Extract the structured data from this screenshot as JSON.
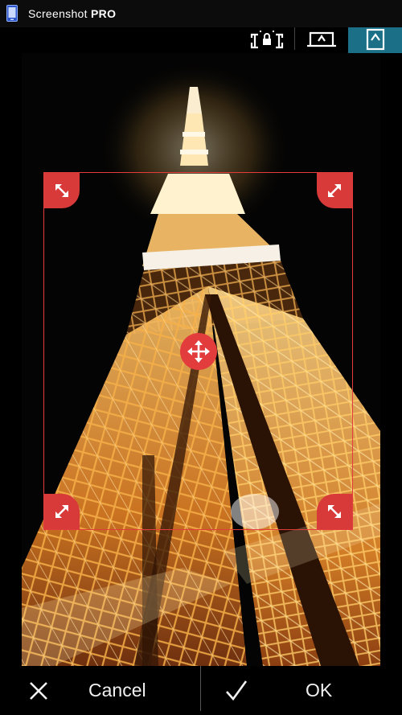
{
  "status_bar": {
    "app_name_regular": "Screenshot ",
    "app_name_bold": "PRO"
  },
  "toolbar": {
    "tools": [
      {
        "icon": "crop-lock-icon"
      },
      {
        "icon": "crop-free-icon"
      },
      {
        "icon": "crop-portrait-icon",
        "active": true
      }
    ],
    "accent_color": "#1b6f86"
  },
  "crop": {
    "frame_color": "#e23c3c",
    "handles": [
      "resize-top-left-icon",
      "resize-top-right-icon",
      "resize-bottom-left-icon",
      "resize-bottom-right-icon",
      "move-icon"
    ]
  },
  "bottom_bar": {
    "cancel_label": "Cancel",
    "ok_label": "OK"
  }
}
